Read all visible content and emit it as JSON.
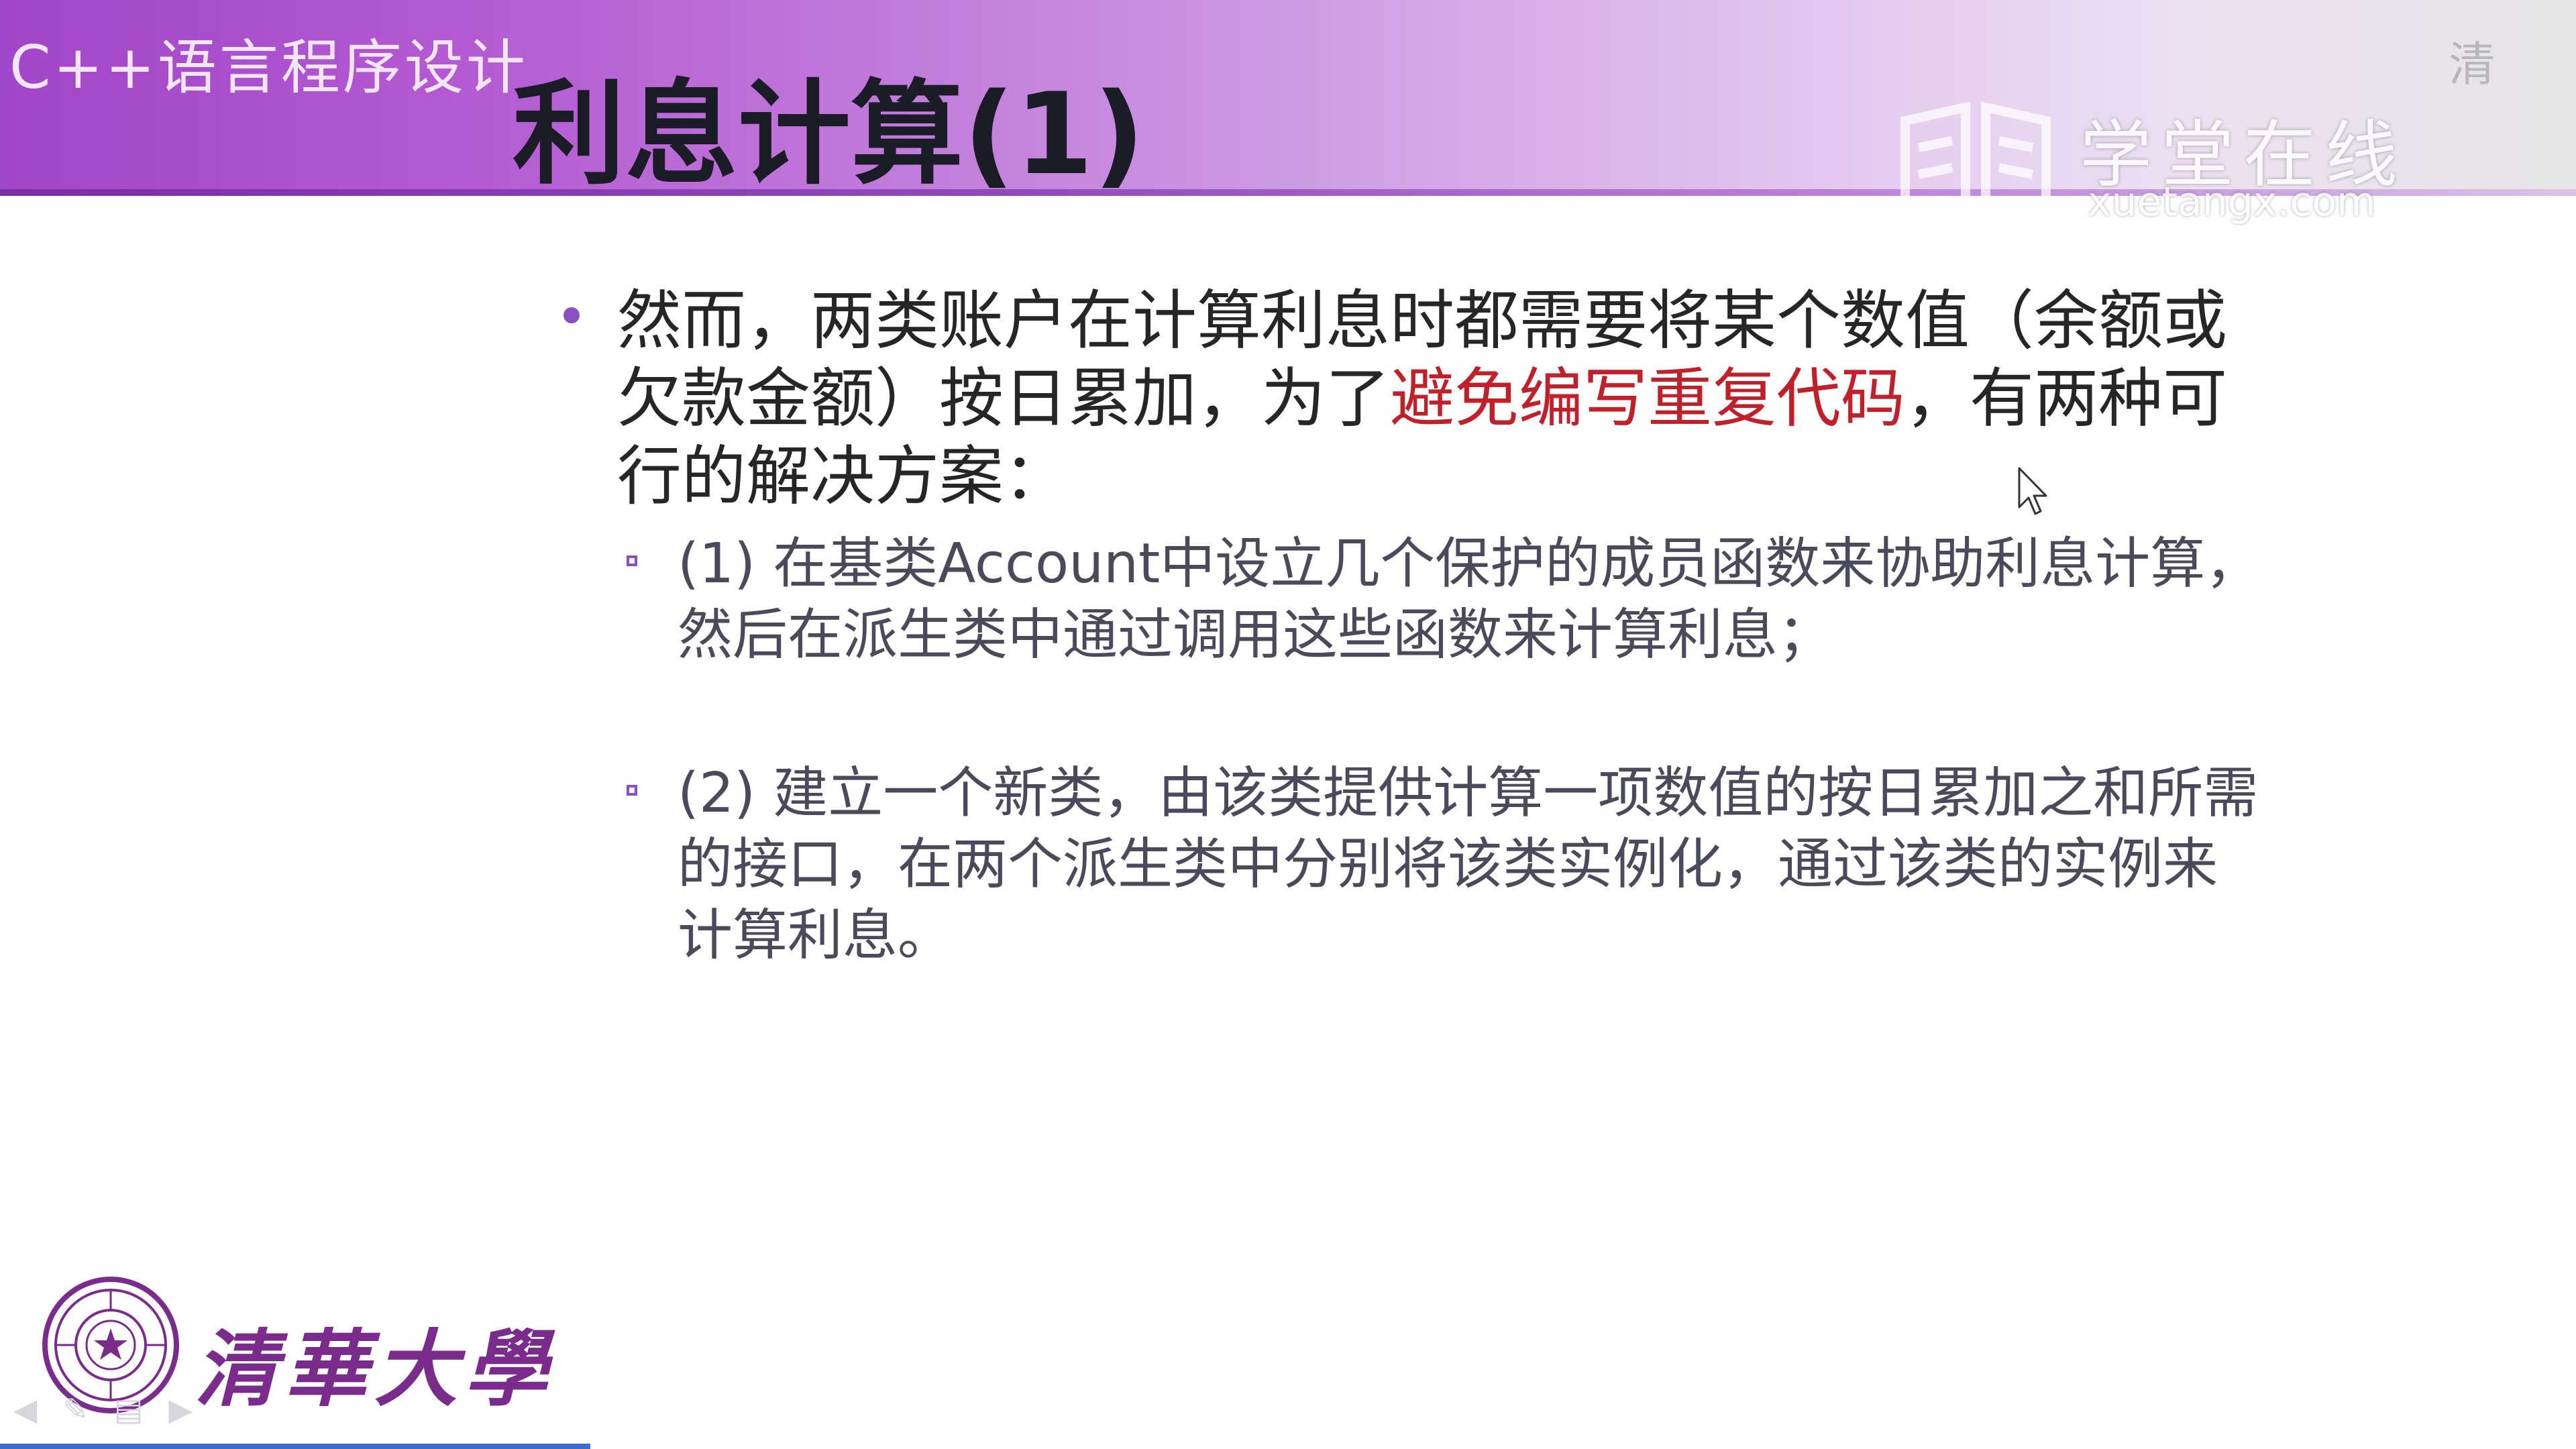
{
  "header": {
    "course_title": "C++语言程序设计",
    "slide_title": "利息计算(1)"
  },
  "watermark": {
    "brand_cn": "学堂在线",
    "brand_en": "xuetangx.com",
    "corner_text": "清"
  },
  "content": {
    "main_bullet": {
      "text_before": "然而，两类账户在计算利息时都需要将某个数值（余额或欠款金额）按日累加，为了",
      "highlight": "避免编写重复代码",
      "text_after": "，有两种可行的解决方案：",
      "highlight_color": "#c0202a"
    },
    "sub_bullets": [
      {
        "text": "(1) 在基类Account中设立几个保护的成员函数来协助利息计算，然后在派生类中通过调用这些函数来计算利息；"
      },
      {
        "text": "(2) 建立一个新类，由该类提供计算一项数值的按日累加之和所需的接口，在两个派生类中分别将该类实例化，通过该类的实例来计算利息。"
      }
    ]
  },
  "footer": {
    "university_name": "清華大學",
    "nav_icons": [
      "back-arrow-icon",
      "pen-icon",
      "menu-icon",
      "forward-arrow-icon"
    ]
  },
  "colors": {
    "accent": "#8a4fc0",
    "header_start": "#a046c8",
    "highlight": "#c0202a"
  }
}
